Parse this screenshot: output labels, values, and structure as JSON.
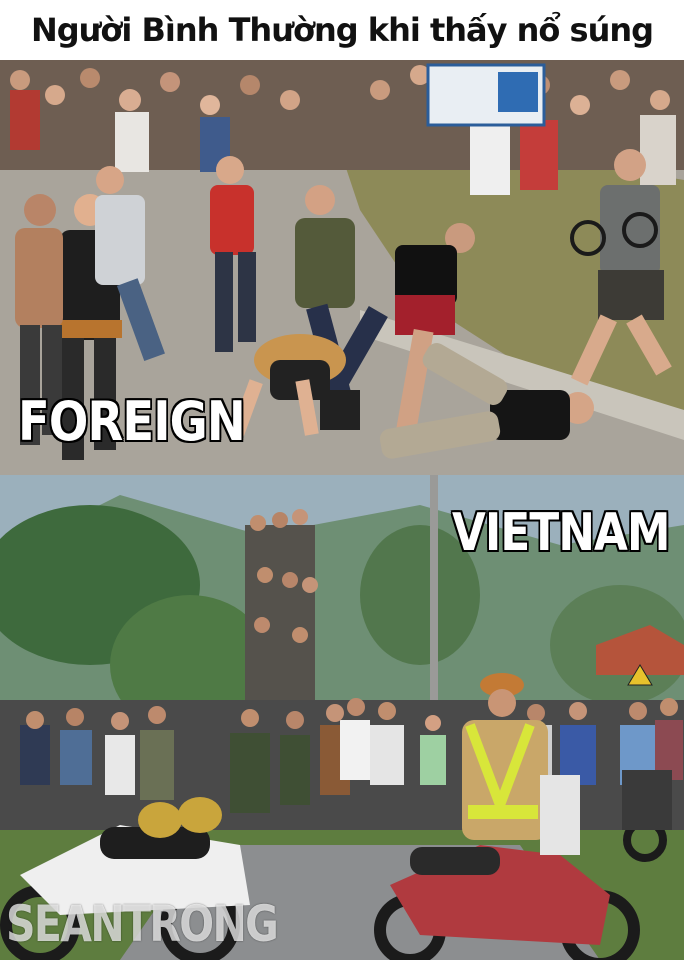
{
  "header": {
    "title": "Người Bình Thường khi thấy nổ súng"
  },
  "panels": {
    "top": {
      "caption": "FOREIGN"
    },
    "bottom": {
      "caption": "VIETNAM",
      "watermark": "SEANTRONG"
    }
  },
  "colors": {
    "caption_fill": "#ffffff",
    "caption_stroke": "#000000",
    "header_background": "#ffffff",
    "header_text": "#111111"
  }
}
